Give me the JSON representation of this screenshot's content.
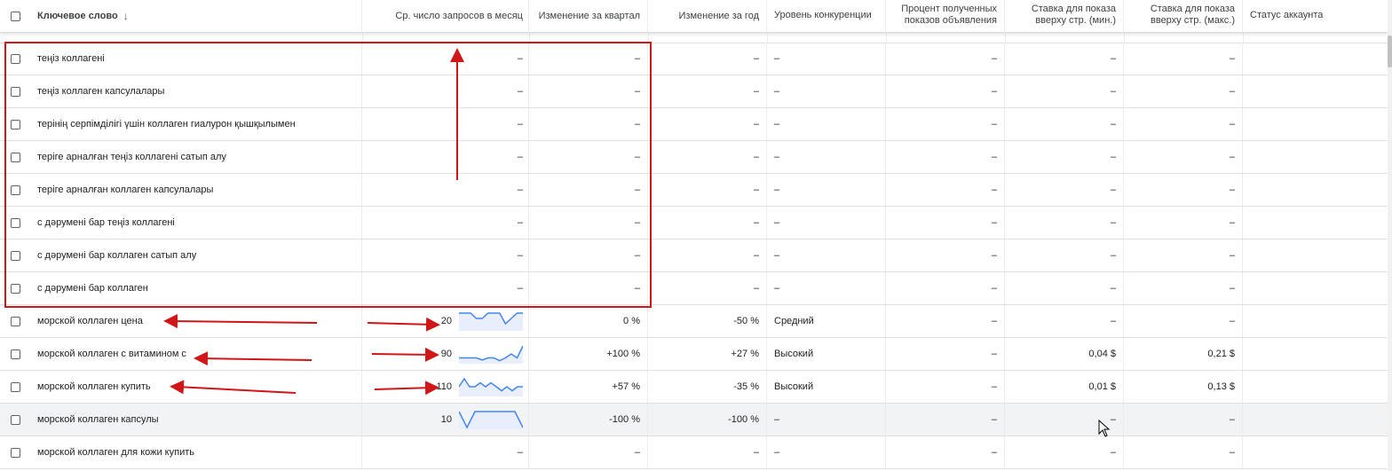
{
  "header": {
    "keyword": "Ключевое слово",
    "sort_icon": "arrow-down-icon",
    "avg": "Ср. число запросов в месяц",
    "quarter": "Изменение за квартал",
    "year": "Изменение за год",
    "competition": "Уровень конкуренции",
    "impr_line1": "Процент полученных",
    "impr_line2": "показов объявления",
    "bid_min_line1": "Ставка для показа",
    "bid_min_line2": "вверху стр. (мин.)",
    "bid_max_line1": "Ставка для показа",
    "bid_max_line2": "вверху стр. (макс.)",
    "status": "Статус аккаунта"
  },
  "rows": [
    {
      "kw": "теңіз коллагені",
      "avg": "–",
      "q": "–",
      "y": "–",
      "comp": "–",
      "pct": "–",
      "min": "–",
      "max": "–"
    },
    {
      "kw": "теңіз коллаген капсулалары",
      "avg": "–",
      "q": "–",
      "y": "–",
      "comp": "–",
      "pct": "–",
      "min": "–",
      "max": "–"
    },
    {
      "kw": "терінің серпімділігі үшін коллаген гиалурон қышқылымен",
      "avg": "–",
      "q": "–",
      "y": "–",
      "comp": "–",
      "pct": "–",
      "min": "–",
      "max": "–"
    },
    {
      "kw": "теріге арналған теңіз коллагені сатып алу",
      "avg": "–",
      "q": "–",
      "y": "–",
      "comp": "–",
      "pct": "–",
      "min": "–",
      "max": "–"
    },
    {
      "kw": "теріге арналған коллаген капсулалары",
      "avg": "–",
      "q": "–",
      "y": "–",
      "comp": "–",
      "pct": "–",
      "min": "–",
      "max": "–"
    },
    {
      "kw": "с дәрумені бар теңіз коллагені",
      "avg": "–",
      "q": "–",
      "y": "–",
      "comp": "–",
      "pct": "–",
      "min": "–",
      "max": "–"
    },
    {
      "kw": "с дәрумені бар коллаген сатып алу",
      "avg": "–",
      "q": "–",
      "y": "–",
      "comp": "–",
      "pct": "–",
      "min": "–",
      "max": "–"
    },
    {
      "kw": "с дәрумені бар коллаген",
      "avg": "–",
      "q": "–",
      "y": "–",
      "comp": "–",
      "pct": "–",
      "min": "–",
      "max": "–"
    },
    {
      "kw": "морской коллаген цена",
      "avg": "20",
      "q": "0 %",
      "y": "-50 %",
      "comp": "Средний",
      "pct": "–",
      "min": "–",
      "max": "–",
      "trend": [
        3,
        3,
        3,
        2,
        2,
        3,
        3,
        3,
        1,
        2,
        3,
        3
      ]
    },
    {
      "kw": "морской коллаген с витамином с",
      "avg": "90",
      "q": "+100 %",
      "y": "+27 %",
      "comp": "Высокий",
      "pct": "–",
      "min": "0,04 $",
      "max": "0,21 $",
      "trend": [
        1,
        1,
        1,
        1,
        0.5,
        1,
        1,
        0.3,
        1,
        2,
        1,
        4
      ]
    },
    {
      "kw": "морской коллаген купить",
      "avg": "110",
      "q": "+57 %",
      "y": "-35 %",
      "comp": "Высокий",
      "pct": "–",
      "min": "0,01 $",
      "max": "0,13 $",
      "trend": [
        2,
        4,
        2,
        2,
        3,
        2,
        3,
        2,
        1,
        2,
        1,
        2,
        2
      ]
    },
    {
      "kw": "морской коллаген капсулы",
      "avg": "10",
      "q": "-100 %",
      "y": "-100 %",
      "comp": "–",
      "pct": "–",
      "min": "–",
      "max": "–",
      "trend": [
        3,
        0,
        3,
        3,
        3,
        3,
        3,
        3,
        0
      ]
    },
    {
      "kw": "морской коллаген для кожи купить",
      "avg": "–",
      "q": "–",
      "y": "–",
      "comp": "–",
      "pct": "–",
      "min": "–",
      "max": "–"
    }
  ],
  "colors": {
    "accent": "#4285f4",
    "annotation": "#d01616"
  },
  "icons": {
    "cursor": "mouse-pointer-icon"
  }
}
